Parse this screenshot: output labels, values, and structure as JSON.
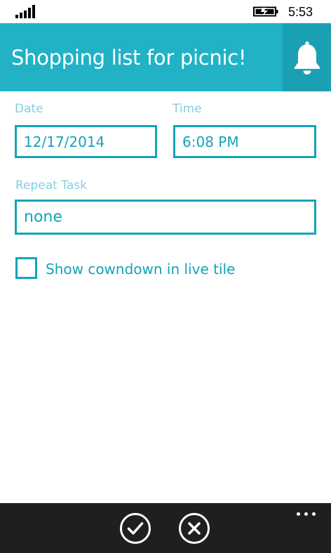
{
  "status_bar": {
    "time": "5:53",
    "signal_icon": "signal-strength-icon",
    "battery_icon": "battery-charging-icon"
  },
  "header": {
    "title": "Shopping list for picnic!",
    "bell_icon": "bell-icon"
  },
  "form": {
    "date_label": "Date",
    "date_value": "12/17/2014",
    "time_label": "Time",
    "time_value": "6:08 PM",
    "repeat_label": "Repeat Task",
    "repeat_value": "none",
    "countdown_label": "Show cowndown in live tile",
    "countdown_checked": false
  },
  "app_bar": {
    "confirm_icon": "check-circle-icon",
    "cancel_icon": "close-circle-icon",
    "more_icon": "ellipsis-icon"
  },
  "colors": {
    "accent": "#21b2c6",
    "accent_dark": "#1aa0b2",
    "field_border": "#12a4b8",
    "label_light": "#84d0db",
    "app_bar": "#1f1f1f"
  }
}
